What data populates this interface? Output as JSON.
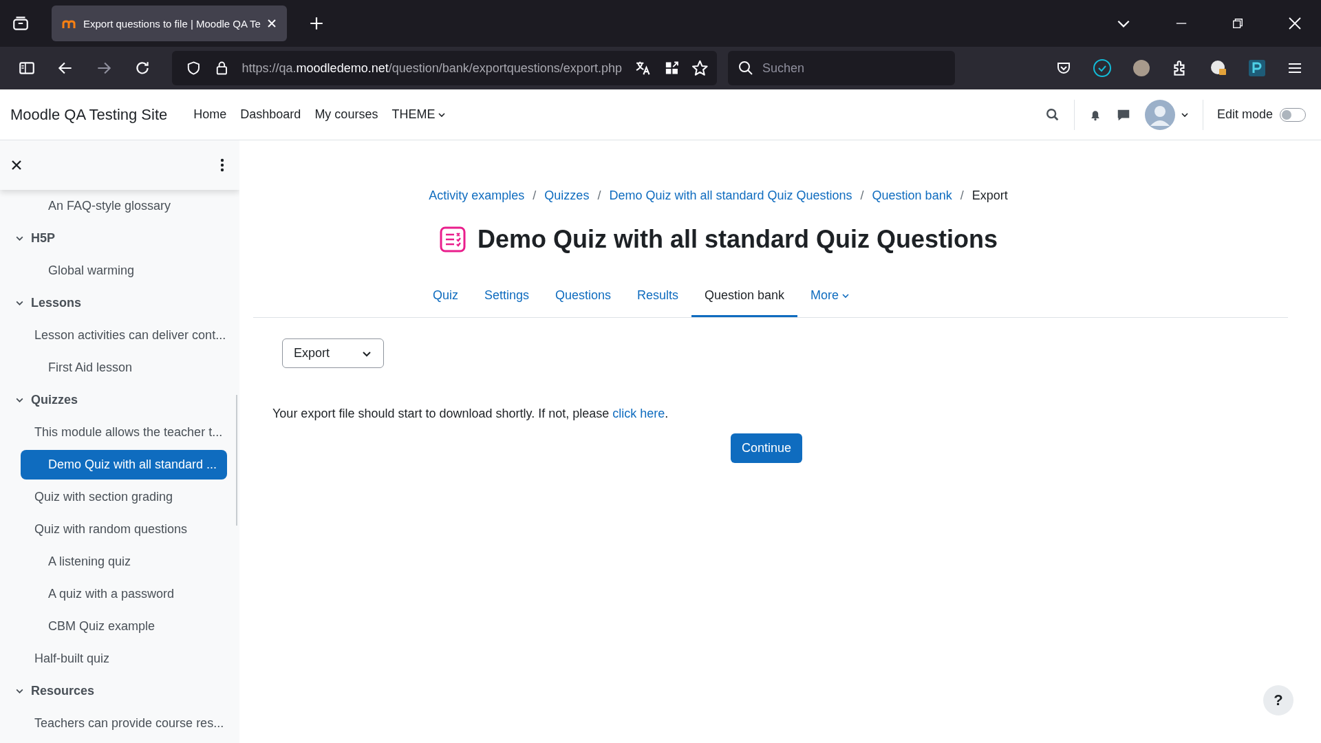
{
  "browser": {
    "tab": {
      "title": "Export questions to file | Moodle QA Te"
    },
    "url": {
      "scheme": "https://qa.",
      "host": "moodledemo.net",
      "path": "/question/bank/exportquestions/export.php"
    },
    "search": {
      "placeholder": "Suchen"
    }
  },
  "navbar": {
    "site_name": "Moodle QA Testing Site",
    "links": [
      {
        "label": "Home",
        "dropdown": false
      },
      {
        "label": "Dashboard",
        "dropdown": false
      },
      {
        "label": "My courses",
        "dropdown": false
      },
      {
        "label": "THEME",
        "dropdown": true
      }
    ],
    "edit_mode": {
      "label": "Edit mode",
      "on": false
    }
  },
  "sidebar": {
    "sections": [
      {
        "children": [
          {
            "label": "An FAQ-style glossary",
            "kind": "indented",
            "selected": false
          }
        ]
      },
      {
        "title": "H5P",
        "expanded": true,
        "children": [
          {
            "label": "Global warming",
            "kind": "indented",
            "selected": false
          }
        ]
      },
      {
        "title": "Lessons",
        "expanded": true,
        "children": [
          {
            "label": "Lesson activities can deliver cont...",
            "kind": "plain",
            "selected": false
          },
          {
            "label": "First Aid lesson",
            "kind": "indented",
            "selected": false
          }
        ]
      },
      {
        "title": "Quizzes",
        "expanded": true,
        "children": [
          {
            "label": "This module allows the teacher t...",
            "kind": "plain",
            "selected": false
          },
          {
            "label": "Demo Quiz with all standard ...",
            "kind": "indented",
            "selected": true
          },
          {
            "label": "Quiz with section grading",
            "kind": "plain",
            "selected": false
          },
          {
            "label": "Quiz with random questions",
            "kind": "plain",
            "selected": false
          },
          {
            "label": "A listening quiz",
            "kind": "indented",
            "selected": false
          },
          {
            "label": "A quiz with a password",
            "kind": "indented",
            "selected": false
          },
          {
            "label": "CBM Quiz example",
            "kind": "indented",
            "selected": false
          },
          {
            "label": "Half-built quiz",
            "kind": "plain",
            "selected": false
          }
        ]
      },
      {
        "title": "Resources",
        "expanded": true,
        "children": [
          {
            "label": "Teachers can provide course res...",
            "kind": "plain",
            "selected": false
          }
        ]
      }
    ]
  },
  "breadcrumb": [
    {
      "label": "Activity examples",
      "current": false,
      "separator": "/"
    },
    {
      "label": "Quizzes",
      "current": false,
      "separator": "/"
    },
    {
      "label": "Demo Quiz with all standard Quiz Questions",
      "current": false,
      "separator": "/"
    },
    {
      "label": "Question bank",
      "current": false,
      "separator": "/"
    },
    {
      "label": "Export",
      "current": true
    }
  ],
  "heading": "Demo Quiz with all standard Quiz Questions",
  "tabs": [
    {
      "label": "Quiz",
      "selected": false,
      "dropdown": false
    },
    {
      "label": "Settings",
      "selected": false,
      "dropdown": false
    },
    {
      "label": "Questions",
      "selected": false,
      "dropdown": false
    },
    {
      "label": "Results",
      "selected": false,
      "dropdown": false
    },
    {
      "label": "Question bank",
      "selected": true,
      "dropdown": false
    },
    {
      "label": "More",
      "selected": false,
      "dropdown": true
    }
  ],
  "action_select": {
    "value": "Export"
  },
  "message": {
    "text": "Your export file should start to download shortly. If not, please ",
    "link": "click here",
    "end": "."
  },
  "continue_button": "Continue",
  "help_button": "?"
}
